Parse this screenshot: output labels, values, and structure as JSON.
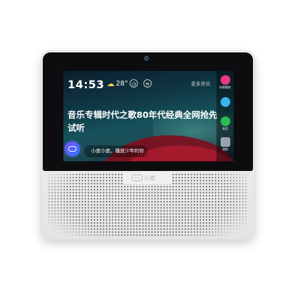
{
  "device": {
    "brand_logo_text": "小度"
  },
  "screen": {
    "time": "14:53",
    "weather_icon": "partly-cloudy-icon",
    "temperature": "28°",
    "more_link": "更多资讯",
    "headline": "音乐专辑时代之歌80年代经典全网抢先试听",
    "voice_prompt": "小度小度，播放少年的你",
    "side_apps": [
      {
        "label": "听歌看剧",
        "icon": "music-icon",
        "color": "#e9388b"
      },
      {
        "label": "",
        "icon": "weather-cloud-icon",
        "color": "#38b6e8"
      },
      {
        "label": "电话",
        "icon": "phone-icon",
        "color": "#2dbb57"
      },
      {
        "label": "视频",
        "icon": "video-icon",
        "color": "#9aa3b0"
      }
    ]
  },
  "colors": {
    "accent": "#2f78ff",
    "screen_bg": "#0f3441"
  }
}
